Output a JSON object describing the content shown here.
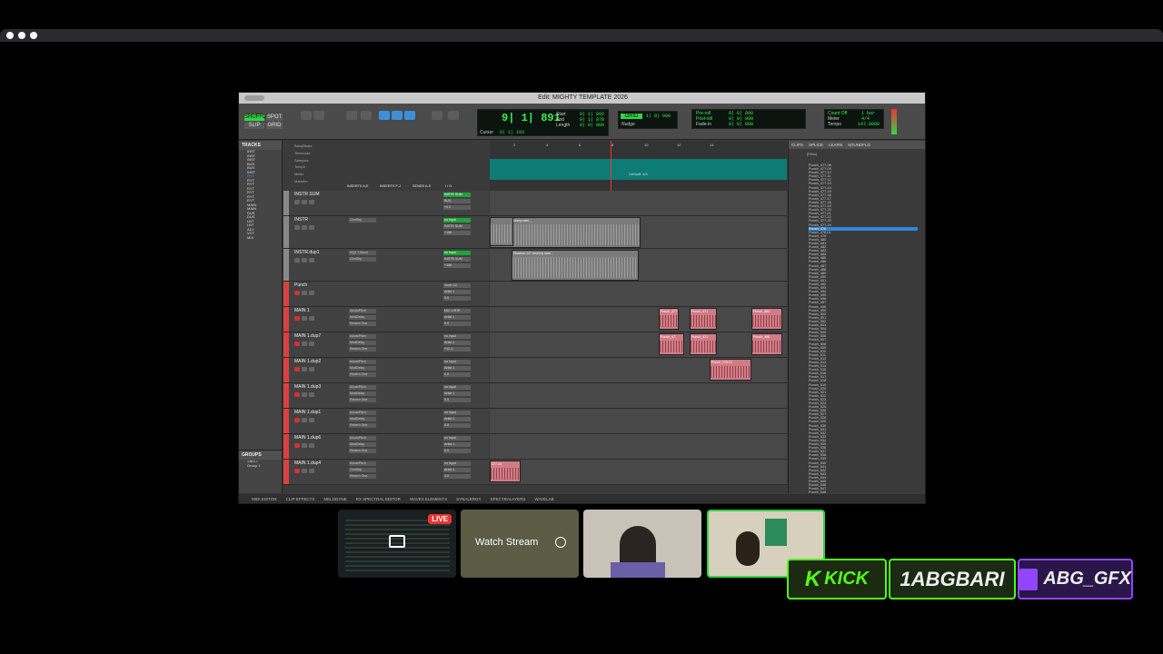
{
  "window": {
    "title": "Edit: MIGHTY TEMPLATE 2026"
  },
  "toolbar": {
    "counter_main": "9| 1| 891",
    "shuffle": "SHUFFLE",
    "spot": "SPOT",
    "slip": "SLIP",
    "grid": "GRID",
    "start_label": "Start",
    "end_label": "End",
    "length_label": "Length",
    "start_val": "9| 1| 892",
    "end_val": "9| 1| 878",
    "length_val": "0| 0| 000",
    "cursor_label": "Cursor",
    "cursor_val": "9| 1| 193",
    "nudge_label": "Nudge",
    "grid_val": "1| 0| 000",
    "preroll": "Pre-roll",
    "postroll": "Post-roll",
    "fadein": "Fade-in",
    "pre_val": "0| 0| 000",
    "post_val": "0| 0| 000",
    "fade_val": "0| 0| 000",
    "countoff": "Count Off",
    "meter": "Meter",
    "tempo": "Tempo",
    "bar_val": "1 bar",
    "meter_val": "4/4",
    "tempo_val": "147.0000"
  },
  "tracks_panel": {
    "title": "TRACKS",
    "items": [
      "INST",
      "INST",
      "INST",
      "BUS",
      "BUS",
      "INST",
      "RYT",
      "RYT",
      "RYT",
      "RYT",
      "RYT",
      "RYT",
      "RYT",
      "MAIN",
      "MAIN",
      "DUS",
      "DUS",
      "LBT",
      "LBT",
      "ADJ",
      "VCT",
      "MIX"
    ],
    "selected": 6
  },
  "groups_panel": {
    "title": "GROUPS",
    "items": [
      "<ALL>",
      "Group 1"
    ]
  },
  "rulers": [
    "Bars|Beats",
    "Timecode",
    "Samples",
    "Tempo",
    "Meter",
    "Markers"
  ],
  "ruler_bars": [
    "2",
    "4",
    "6",
    "8",
    "10",
    "12",
    "14"
  ],
  "marker_label": "Default: 4/4",
  "mix_headers": [
    "INSERTS A-E",
    "INSERTS F-J",
    "SENDS A-E",
    "I / O"
  ],
  "tracks": [
    {
      "name": "INSTR SUM",
      "color": "#888888",
      "inserts": [],
      "io": [
        "INSTR SUM",
        "BUS",
        "+0.0"
      ],
      "io_green": false
    },
    {
      "name": "INSTR",
      "color": "#888888",
      "inserts": [
        "ChnStrp"
      ],
      "io": [
        "no input",
        "INSTR SUM",
        "+156"
      ],
      "io_green": false
    },
    {
      "name": "INSTR.dup1",
      "color": "#888888",
      "inserts": [
        "EQ3 7-Band",
        "ChnStrp"
      ],
      "io": [
        "no input",
        "INSTR SUM",
        "+156"
      ],
      "io_green": false
    },
    {
      "name": "Punch",
      "color": "#d94040",
      "inserts": [],
      "io": [
        "Vox# 1/2",
        "Artist 1",
        "0.0"
      ],
      "io_green": false
    },
    {
      "name": "MAIN 1",
      "color": "#d94040",
      "inserts": [
        "AAutoPitch",
        "ModDelay",
        "Reverb One"
      ],
      "io": [
        "MIC L/RTE",
        "Artist 1",
        "0.0"
      ],
      "io_green": false
    },
    {
      "name": "MAIN 1.dup7",
      "color": "#d94040",
      "inserts": [
        "AAutoPitch",
        "ModDelay",
        "Reverb One"
      ],
      "io": [
        "no input",
        "Artist 1",
        "+12.1"
      ],
      "io_green": false
    },
    {
      "name": "MAIN 1.dup2",
      "color": "#d94040",
      "inserts": [
        "AAutoPitch",
        "ModDelay",
        "Reverb One"
      ],
      "io": [
        "no input",
        "Artist 1",
        "0.0"
      ],
      "io_green": false
    },
    {
      "name": "MAIN 1.dup3",
      "color": "#d94040",
      "inserts": [
        "AAutoPitch",
        "ModDelay",
        "Reverb One"
      ],
      "io": [
        "no input",
        "Artist 1",
        "0.0"
      ],
      "io_green": false
    },
    {
      "name": "MAIN 1.dup1",
      "color": "#d94040",
      "inserts": [
        "AAutoPitch",
        "ModDelay",
        "Reverb One"
      ],
      "io": [
        "no input",
        "Artist 1",
        "0.0"
      ],
      "io_green": false
    },
    {
      "name": "MAIN 1.dup6",
      "color": "#d94040",
      "inserts": [
        "AAutoPitch",
        "ModDelay",
        "Reverb One"
      ],
      "io": [
        "no input",
        "Artist 1",
        "0.0"
      ],
      "io_green": false
    },
    {
      "name": "MAIN 1.dup4",
      "color": "#d94040",
      "inserts": [
        "AAutoPitch",
        "ChnStrp",
        "Reverb One"
      ],
      "io": [
        "no input",
        "Artist 1",
        "0.0"
      ],
      "io_green": false
    }
  ],
  "clips_edit": [
    {
      "label": "Shadow-147 bruhmy sam...",
      "color": "gray"
    },
    {
      "label": "Shadow-147 bruhmy sam...",
      "color": "gray"
    },
    {
      "label": "Punch_477",
      "color": "pink"
    },
    {
      "label": "Punch_471",
      "color": "pink"
    },
    {
      "label": "Punch_463",
      "color": "pink"
    },
    {
      "label": "Punch_47",
      "color": "pink"
    },
    {
      "label": "Punch_471",
      "color": "pink"
    },
    {
      "label": "Punch_466",
      "color": "pink"
    },
    {
      "label": "Punch_478.01",
      "color": "pink"
    },
    {
      "label": "477-24",
      "color": "pink"
    }
  ],
  "clips_panel": {
    "tabs": [
      "CLIPS",
      "SPLICE",
      "LEARN",
      "SOUNDFLO"
    ],
    "filter": "[Filter]",
    "items": [
      "Punch_477-08",
      "Punch_477-09",
      "Punch_477-10",
      "Punch_477-11",
      "Punch_477-12",
      "Punch_477-13",
      "Punch_477-14",
      "Punch_477-15",
      "Punch_477-16",
      "Punch_477-17",
      "Punch_477-18",
      "Punch_477-19",
      "Punch_477-20",
      "Punch_477-21",
      "Punch_477-22",
      "Punch_477-23",
      "Punch_477-24",
      "Punch_478",
      "Punch_478-01",
      "Punch_479",
      "Punch_480",
      "Punch_481",
      "Punch_482",
      "Punch_483",
      "Punch_484",
      "Punch_485",
      "Punch_486",
      "Punch_487",
      "Punch_488",
      "Punch_489",
      "Punch_490",
      "Punch_491",
      "Punch_492",
      "Punch_493",
      "Punch_494",
      "Punch_495",
      "Punch_496",
      "Punch_497",
      "Punch_498",
      "Punch_499",
      "Punch_500",
      "Punch_501",
      "Punch_502",
      "Punch_503",
      "Punch_504",
      "Punch_505",
      "Punch_506",
      "Punch_507",
      "Punch_508",
      "Punch_509",
      "Punch_510",
      "Punch_511",
      "Punch_512",
      "Punch_513",
      "Punch_514",
      "Punch_515",
      "Punch_516",
      "Punch_517",
      "Punch_518",
      "Punch_519",
      "Punch_520",
      "Punch_521",
      "Punch_522",
      "Punch_523",
      "Punch_524",
      "Punch_525",
      "Punch_526",
      "Punch_527",
      "Punch_528",
      "Punch_529",
      "Punch_530",
      "Punch_531",
      "Punch_532",
      "Punch_533",
      "Punch_534",
      "Punch_535",
      "Punch_536",
      "Punch_537",
      "Punch_538",
      "Punch_539",
      "Punch_540",
      "Punch_541",
      "Punch_542",
      "Punch_543",
      "Punch_544",
      "Punch_545",
      "Punch_546",
      "Punch_547",
      "Punch_548"
    ],
    "selected": 17
  },
  "bottom_tabs": [
    "MIDI EDITOR",
    "CLIP EFFECTS",
    "MELODYNE",
    "RX SPECTRAL EDITOR",
    "WAVES ELEMENTS",
    "SYNALERGY",
    "SPECTRALAYERS",
    "WAVELAB"
  ],
  "stream": {
    "live_badge": "LIVE",
    "watch_label": "Watch Stream"
  },
  "socials": {
    "kick_label": "KICK",
    "kick_user": "1ABGBARI",
    "twitch_user": "ABG_GFX"
  },
  "colors": {
    "green": "#2fd640",
    "kick": "#53fc18",
    "twitch": "#9146ff",
    "accent": "#3c8fd8"
  }
}
